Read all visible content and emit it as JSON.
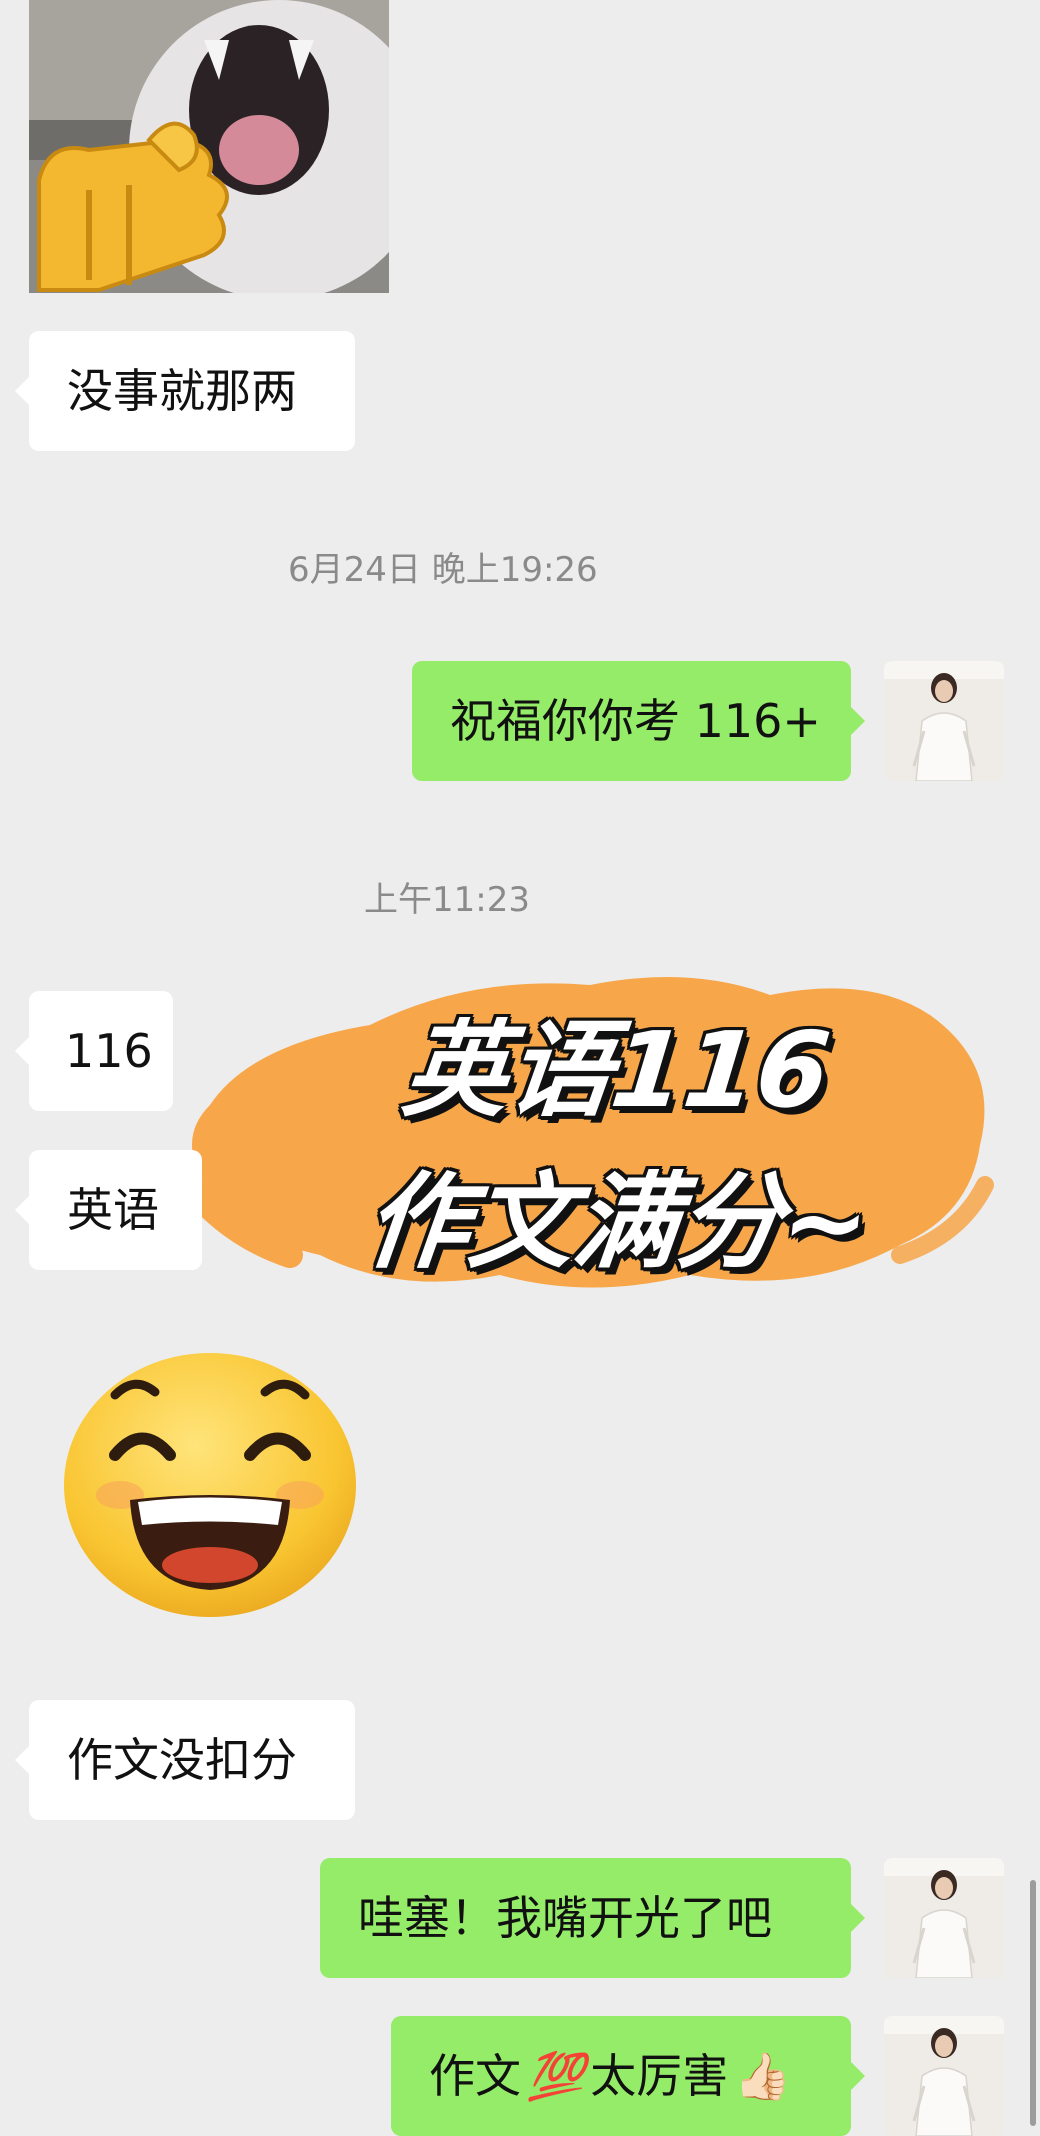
{
  "messages": {
    "m1": "没事就那两",
    "m2": "祝福你你考 116+",
    "m3": "116",
    "m4": "英语",
    "m5": "作文没扣分",
    "m6": "哇塞！我嘴开光了吧",
    "m7_prefix": "作文",
    "m7_mid": "太厉害",
    "m7_emoji_100": "💯",
    "m7_emoji_thumb": "👍🏻"
  },
  "timestamps": {
    "t1": "6月24日 晚上19:26",
    "t2": "上午11:23"
  },
  "overlay": {
    "line1": "英语116",
    "line2": "作文满分~"
  },
  "icons": {
    "sticker_cat": "cat-with-thumb-sticker",
    "sticker_smile": "grinning-face-sticker",
    "avatar": "woman-in-white-avatar"
  },
  "colors": {
    "background": "#ededed",
    "incoming_bubble": "#ffffff",
    "outgoing_bubble": "#95ec69",
    "timestamp": "#8a8a8a",
    "overlay_blob": "#f7a74a"
  }
}
